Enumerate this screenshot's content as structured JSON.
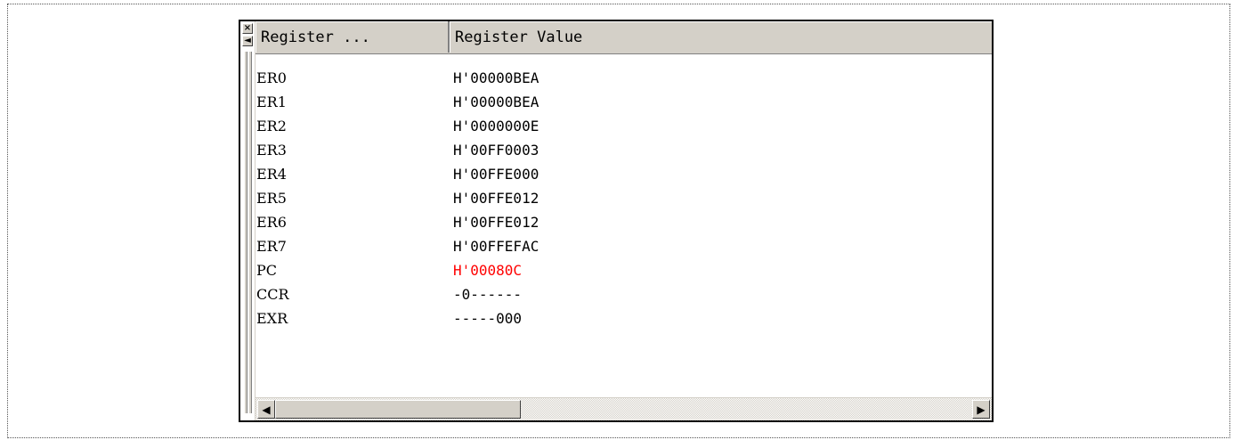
{
  "panel": {
    "close_glyph": "×",
    "minimize_glyph": "◄"
  },
  "columns": {
    "name_header": "Register ...",
    "value_header": "Register Value"
  },
  "registers": [
    {
      "name": "ER0",
      "value": "H'00000BEA",
      "changed": false
    },
    {
      "name": "ER1",
      "value": "H'00000BEA",
      "changed": false
    },
    {
      "name": "ER2",
      "value": "H'0000000E",
      "changed": false
    },
    {
      "name": "ER3",
      "value": "H'00FF0003",
      "changed": false
    },
    {
      "name": "ER4",
      "value": "H'00FFE000",
      "changed": false
    },
    {
      "name": "ER5",
      "value": "H'00FFE012",
      "changed": false
    },
    {
      "name": "ER6",
      "value": "H'00FFE012",
      "changed": false
    },
    {
      "name": "ER7",
      "value": "H'00FFEFAC",
      "changed": false
    },
    {
      "name": "PC",
      "value": "H'00080C",
      "changed": true
    },
    {
      "name": "CCR",
      "value": "-0------",
      "changed": false
    },
    {
      "name": "EXR",
      "value": "-----000",
      "changed": false
    }
  ],
  "scrollbar": {
    "left_arrow": "◀",
    "right_arrow": "▶"
  },
  "colors": {
    "changed_value": "#ff0000",
    "chrome": "#d4d0c8"
  },
  "icons": {
    "close": "close-icon",
    "minimize": "collapse-left-icon",
    "scroll_left": "arrow-left-icon",
    "scroll_right": "arrow-right-icon"
  }
}
